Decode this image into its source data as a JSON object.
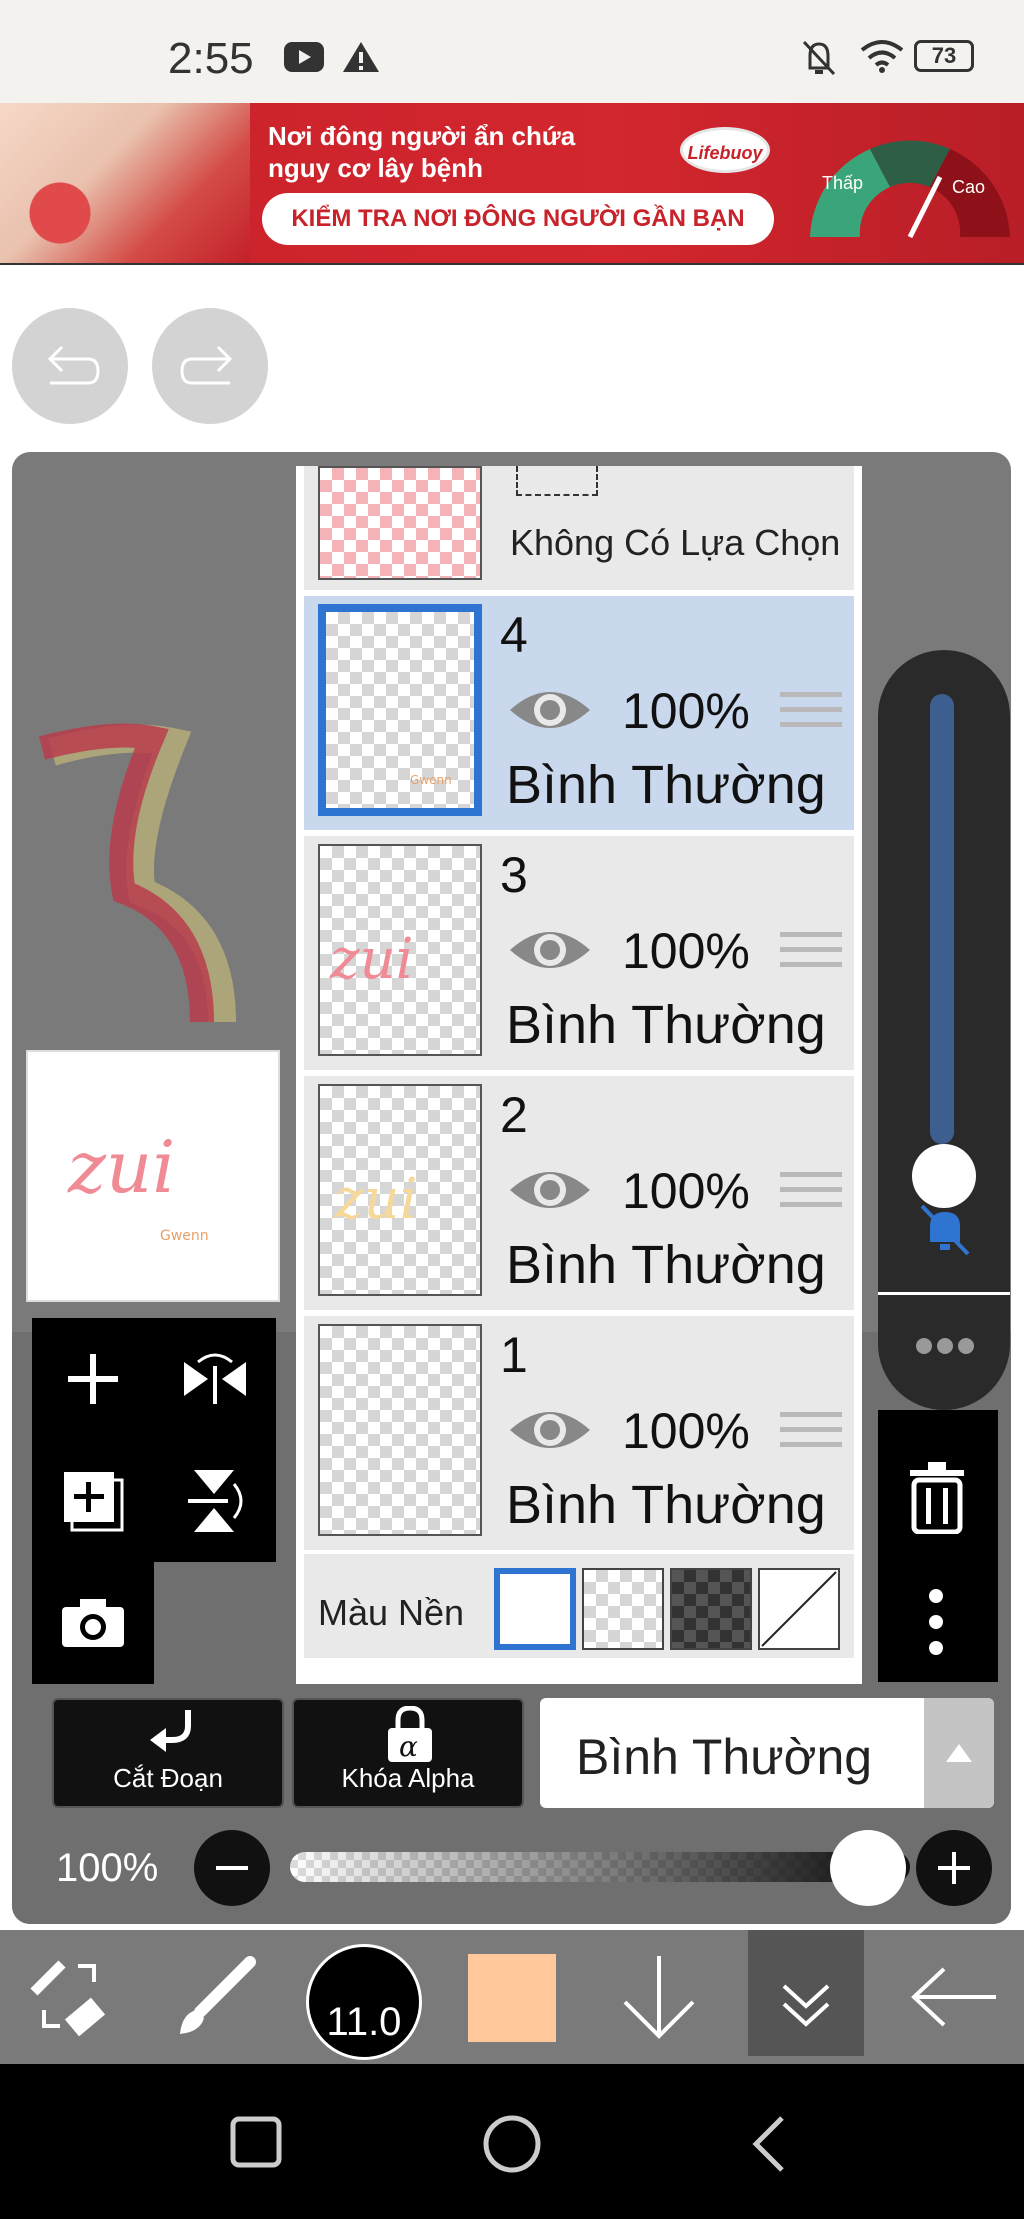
{
  "status_bar": {
    "time": "2:55",
    "battery": "73",
    "icons": [
      "youtube-icon",
      "warning-icon",
      "bell-off-icon",
      "wifi-icon",
      "battery-icon"
    ]
  },
  "ad": {
    "line1": "Nơi đông người ẩn chứa",
    "line2": "nguy cơ lây bệnh",
    "cta": "KIỂM TRA NƠI ĐÔNG NGƯỜI GẦN BẠN",
    "brand": "Lifebuoy",
    "gauge_low": "Thấp",
    "gauge_high": "Cao"
  },
  "layers": {
    "selection_label": "Không Có Lựa Chọn",
    "items": [
      {
        "number": "4",
        "opacity": "100%",
        "blend": "Bình Thường",
        "selected": true
      },
      {
        "number": "3",
        "opacity": "100%",
        "blend": "Bình Thường",
        "selected": false
      },
      {
        "number": "2",
        "opacity": "100%",
        "blend": "Bình Thường",
        "selected": false
      },
      {
        "number": "1",
        "opacity": "100%",
        "blend": "Bình Thường",
        "selected": false
      }
    ],
    "background_label": "Màu Nền"
  },
  "actions": {
    "clip_label": "Cắt Đoạn",
    "alpha_lock_label": "Khóa Alpha",
    "blend_mode": "Bình Thường"
  },
  "opacity": {
    "label": "100%",
    "value": 1.0
  },
  "toolbar": {
    "brush_size": "11.0",
    "color": "#ffc89d"
  },
  "colors": {
    "selection_blue": "#2f74d0",
    "selected_layer_bg": "#c9d8ec",
    "ad_red": "#c8222b"
  }
}
